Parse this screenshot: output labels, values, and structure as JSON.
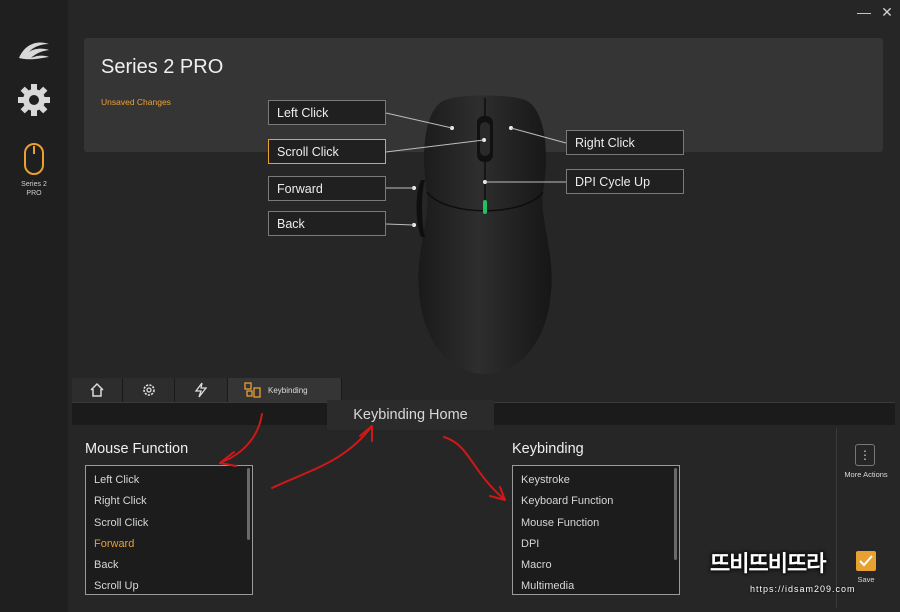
{
  "device": {
    "title": "Series 2 PRO",
    "status": "Unsaved Changes",
    "sidebar_label_line1": "Series 2",
    "sidebar_label_line2": "PRO"
  },
  "window": {
    "minimize": "—",
    "close": "✕"
  },
  "callouts": {
    "left_click": "Left Click",
    "scroll_click": "Scroll Click",
    "forward": "Forward",
    "back": "Back",
    "right_click": "Right Click",
    "dpi_cycle_up": "DPI Cycle Up"
  },
  "tabs": {
    "keybinding_label": "Keybinding"
  },
  "keybinding_home": "Keybinding Home",
  "mouse_function": {
    "title": "Mouse Function",
    "items": [
      "Left Click",
      "Right Click",
      "Scroll Click",
      "Forward",
      "Back",
      "Scroll Up"
    ],
    "selected": "Forward"
  },
  "keybinding": {
    "title": "Keybinding",
    "items": [
      "Keystroke",
      "Keyboard Function",
      "Mouse Function",
      "DPI",
      "Macro",
      "Multimedia"
    ]
  },
  "actions": {
    "more_actions": "More Actions",
    "more_glyph": "⋮",
    "save": "Save"
  },
  "watermark": {
    "big": "뜨비뜨비뜨라",
    "url": "https://idsam209.com"
  },
  "colors": {
    "accent": "#e8a030",
    "annotation": "#d01818",
    "background": "#262626",
    "panel": "#353535"
  }
}
